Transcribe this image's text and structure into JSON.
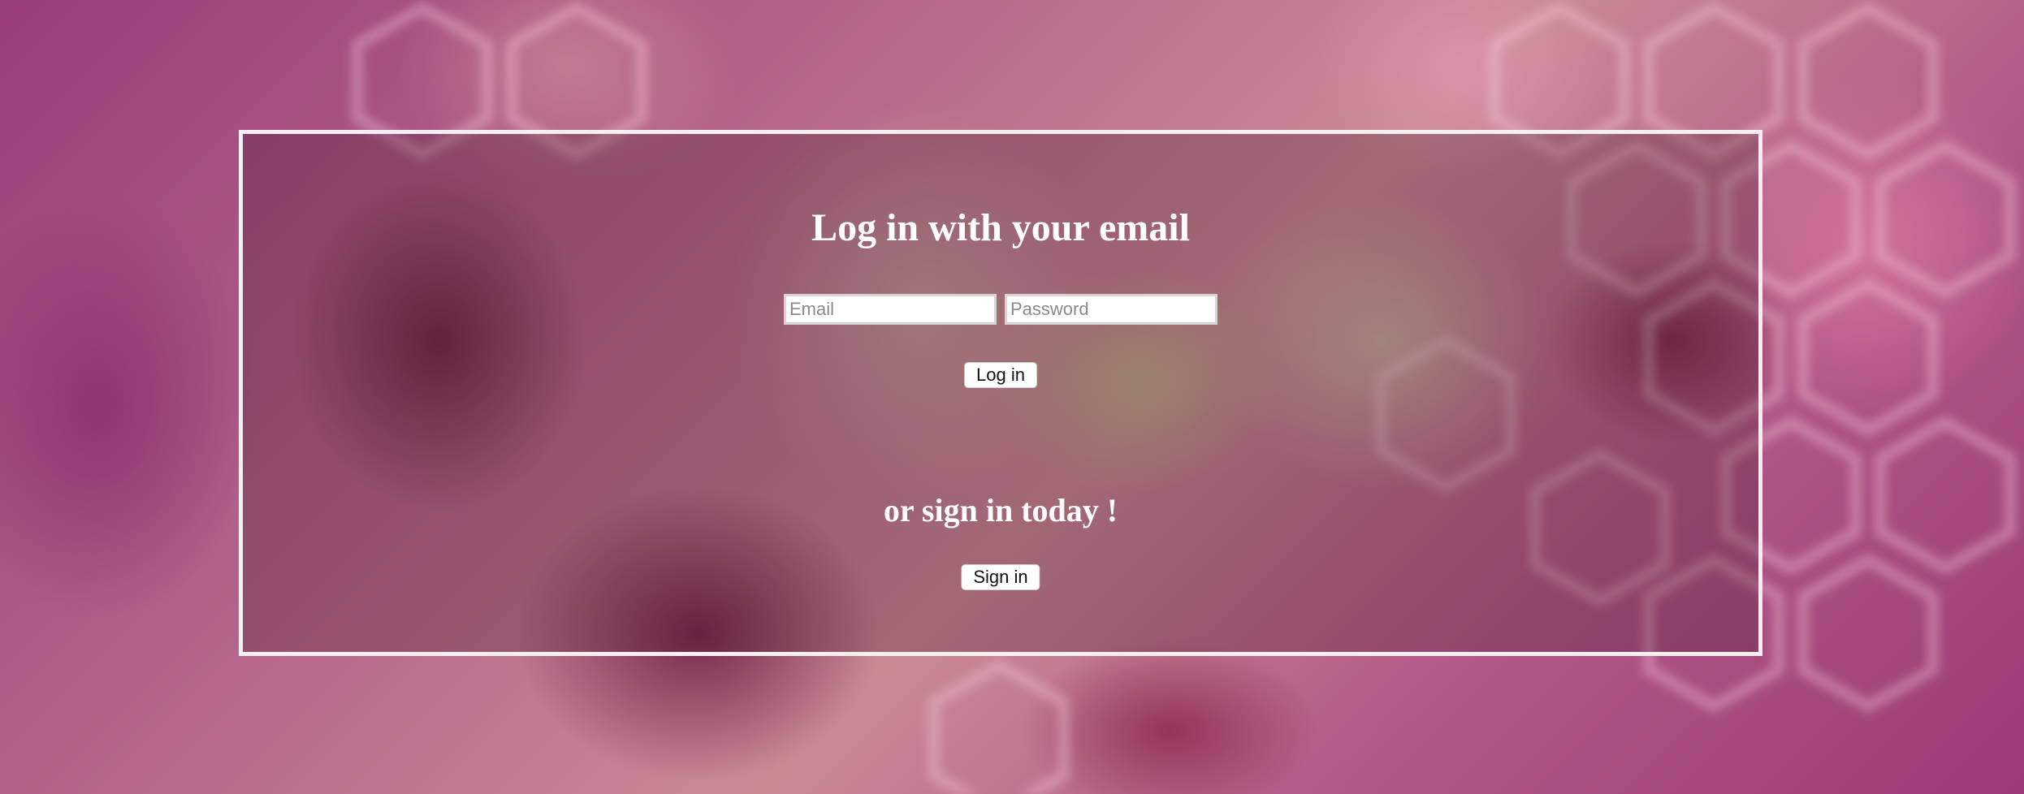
{
  "login": {
    "title": "Log in with your email",
    "email_placeholder": "Email",
    "password_placeholder": "Password",
    "login_label": "Log in"
  },
  "signup": {
    "subtitle": "or sign in today !",
    "signin_label": "Sign in"
  },
  "colors": {
    "panel_border": "#f4f0f2",
    "text": "#ffffff"
  }
}
